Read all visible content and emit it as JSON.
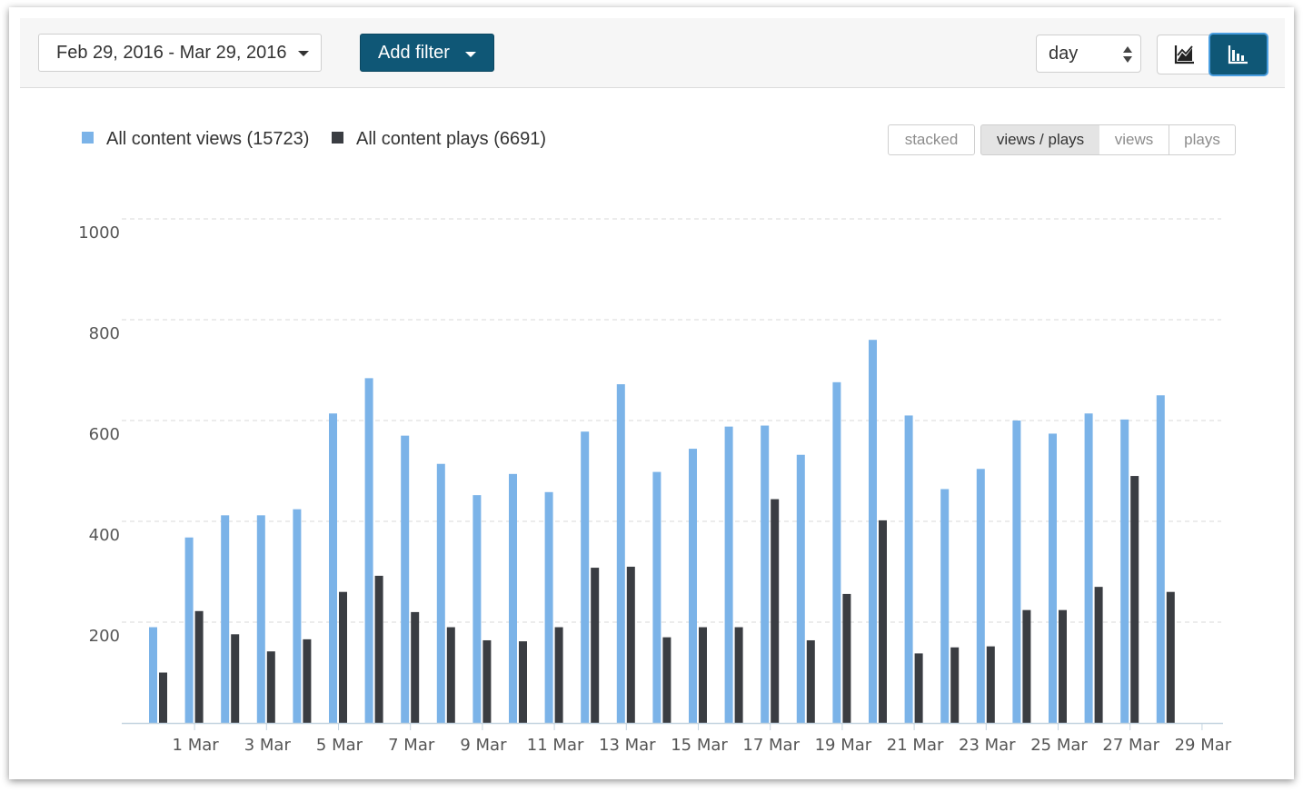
{
  "toolbar": {
    "date_range": "Feb 29, 2016 - Mar 29, 2016",
    "add_filter": "Add filter",
    "interval": "day",
    "chart_view_icons": [
      "line-chart-icon",
      "bar-chart-icon"
    ]
  },
  "legend": [
    {
      "label": "All content views (15723)",
      "color": "#7bb3e8"
    },
    {
      "label": "All content plays (6691)",
      "color": "#3a3d42"
    }
  ],
  "display_modes": [
    {
      "label": "stacked",
      "active": false
    },
    {
      "label": "views / plays",
      "active": true
    },
    {
      "label": "views",
      "active": false
    },
    {
      "label": "plays",
      "active": false
    }
  ],
  "colors": {
    "accent": "#0f5776",
    "views": "#7bb3e8",
    "plays": "#3a3d42"
  },
  "chart_data": {
    "type": "bar",
    "categories": [
      "29 Feb",
      "1 Mar",
      "2 Mar",
      "3 Mar",
      "4 Mar",
      "5 Mar",
      "6 Mar",
      "7 Mar",
      "8 Mar",
      "9 Mar",
      "10 Mar",
      "11 Mar",
      "12 Mar",
      "13 Mar",
      "14 Mar",
      "15 Mar",
      "16 Mar",
      "17 Mar",
      "18 Mar",
      "19 Mar",
      "20 Mar",
      "21 Mar",
      "22 Mar",
      "23 Mar",
      "24 Mar",
      "25 Mar",
      "26 Mar",
      "27 Mar",
      "28 Mar",
      "29 Mar"
    ],
    "tick_labels": [
      "1 Mar",
      "3 Mar",
      "5 Mar",
      "7 Mar",
      "9 Mar",
      "11 Mar",
      "13 Mar",
      "15 Mar",
      "17 Mar",
      "19 Mar",
      "21 Mar",
      "23 Mar",
      "25 Mar",
      "27 Mar",
      "29 Mar"
    ],
    "series": [
      {
        "name": "All content views (15723)",
        "values": [
          190,
          368,
          412,
          412,
          424,
          614,
          684,
          570,
          514,
          452,
          494,
          458,
          578,
          672,
          498,
          544,
          588,
          590,
          532,
          676,
          760,
          610,
          464,
          504,
          600,
          574,
          614,
          602,
          650,
          0
        ]
      },
      {
        "name": "All content plays (6691)",
        "values": [
          100,
          222,
          176,
          142,
          166,
          260,
          292,
          220,
          190,
          164,
          162,
          190,
          308,
          310,
          170,
          190,
          190,
          444,
          164,
          256,
          402,
          138,
          150,
          152,
          224,
          224,
          270,
          490,
          260,
          0
        ]
      }
    ],
    "yticks": [
      200,
      400,
      600,
      800,
      1000
    ],
    "ylim": [
      0,
      1000
    ],
    "grid": true,
    "legend_position": "top-left"
  }
}
